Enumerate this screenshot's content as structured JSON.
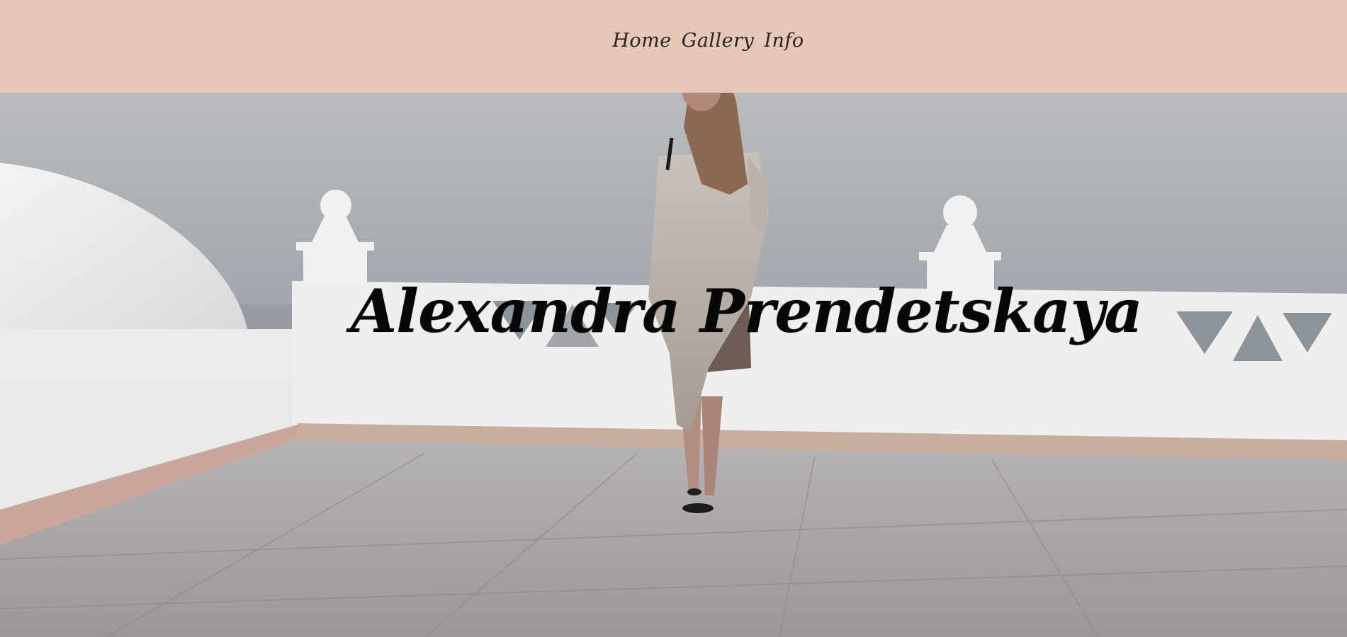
{
  "nav": {
    "items": [
      {
        "label": "Home"
      },
      {
        "label": "Gallery"
      },
      {
        "label": "Info"
      }
    ]
  },
  "hero": {
    "title": "Alexandra Prendetskaya",
    "photo_icon": "woman-on-white-terrace-photo"
  },
  "colors": {
    "navbar_bg": "#e7c8b8",
    "title_text": "#060606",
    "nav_text": "#2a2222",
    "sky": "#a9aeb3",
    "wall": "#efefee",
    "floor": "#a5a1a4"
  }
}
